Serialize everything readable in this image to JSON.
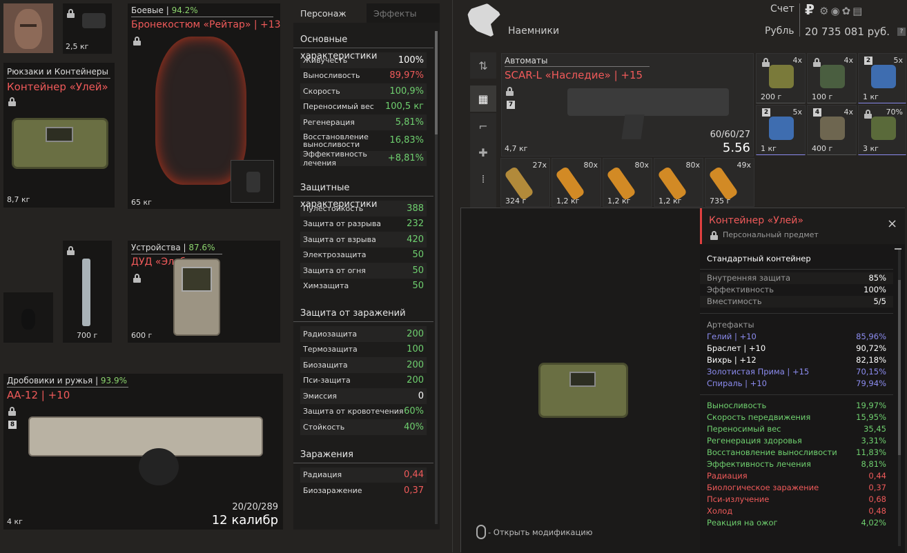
{
  "equipment": {
    "head_weight": "2,5 кг",
    "backpack": {
      "category": "Рюкзаки и Контейнеры",
      "name": "Контейнер «Улей»",
      "weight": "8,7 кг"
    },
    "armor": {
      "category": "Боевые",
      "durability": "94.2%",
      "name": "Бронекостюм «Рейтар» | +13",
      "weight": "65 кг"
    },
    "knife_weight": "700 г",
    "device": {
      "category": "Устройства",
      "durability": "87.6%",
      "name": "ДУД «Эльбрус»",
      "weight": "600 г"
    },
    "weapon": {
      "category": "Дробовики и ружья",
      "durability": "93.9%",
      "name": "АА-12 | +10",
      "weight": "4 кг",
      "ammo": "20/20/289",
      "caliber": "12 калибр",
      "badge": "8"
    }
  },
  "stats": {
    "tabs": [
      "Персонаж",
      "Эффекты"
    ],
    "main_title": "Основные характеристики",
    "main": [
      {
        "label": "Живучесть",
        "value": "100%",
        "color": "#ffffff"
      },
      {
        "label": "Выносливость",
        "value": "89,97%",
        "color": "#f05a5a"
      },
      {
        "label": "Скорость",
        "value": "100,9%",
        "color": "#6fd06f"
      },
      {
        "label": "Переносимый вес",
        "value": "100,5 кг",
        "color": "#6fd06f"
      },
      {
        "label": "Регенерация",
        "value": "5,81%",
        "color": "#6fd06f"
      },
      {
        "label": "Восстановление выносливости",
        "value": "16,83%",
        "color": "#6fd06f"
      },
      {
        "label": "Эффективность лечения",
        "value": "+8,81%",
        "color": "#6fd06f"
      }
    ],
    "prot_title": "Защитные характеристики",
    "prot": [
      {
        "label": "Пулестойкость",
        "value": "388"
      },
      {
        "label": "Защита от разрыва",
        "value": "232"
      },
      {
        "label": "Защита от взрыва",
        "value": "420"
      },
      {
        "label": "Электрозащита",
        "value": "50"
      },
      {
        "label": "Защита от огня",
        "value": "50"
      },
      {
        "label": "Химзащита",
        "value": "50"
      }
    ],
    "cont_title": "Защита от заражений",
    "cont": [
      {
        "label": "Радиозащита",
        "value": "200",
        "color": "#6fd06f"
      },
      {
        "label": "Термозащита",
        "value": "100",
        "color": "#6fd06f"
      },
      {
        "label": "Биозащита",
        "value": "200",
        "color": "#6fd06f"
      },
      {
        "label": "Пси-защита",
        "value": "200",
        "color": "#6fd06f"
      },
      {
        "label": "Эмиссия",
        "value": "0",
        "color": "#ffffff"
      },
      {
        "label": "Защита от кровотечения",
        "value": "60%",
        "color": "#6fd06f"
      },
      {
        "label": "Стойкость",
        "value": "40%",
        "color": "#6fd06f"
      }
    ],
    "inf_title": "Заражения",
    "inf": [
      {
        "label": "Радиация",
        "value": "0,44"
      },
      {
        "label": "Биозаражение",
        "value": "0,37"
      }
    ]
  },
  "header": {
    "faction": "Наемники",
    "account_label": "Счет",
    "currency": "Рубль",
    "money": "20 735 081 руб."
  },
  "rifle": {
    "category": "Автоматы",
    "name": "SCAR-L «Наследие» | +15",
    "weight": "4,7 кг",
    "ammo": "60/60/27",
    "caliber": "5.56",
    "badge": "7"
  },
  "top_items": [
    {
      "count": "4x",
      "weight": "200 г"
    },
    {
      "count": "4x",
      "weight": "100 г"
    },
    {
      "count": "5x",
      "weight": "1 кг",
      "badge": "2"
    },
    {
      "count": "5x",
      "weight": "1 кг",
      "badge": "2"
    },
    {
      "count": "4x",
      "weight": "400 г",
      "badge": "4"
    },
    {
      "count": "70%",
      "weight": "3 кг"
    }
  ],
  "ammo_items": [
    {
      "count": "27x",
      "weight": "324 г"
    },
    {
      "count": "80x",
      "weight": "1,2 кг"
    },
    {
      "count": "80x",
      "weight": "1,2 кг"
    },
    {
      "count": "80x",
      "weight": "1,2 кг"
    },
    {
      "count": "49x",
      "weight": "735 г"
    }
  ],
  "popup": {
    "title": "Контейнер «Улей»",
    "subtitle": "Персональный предмет",
    "type": "Стандартный контейнер",
    "props": [
      {
        "label": "Внутренняя защита",
        "value": "85%"
      },
      {
        "label": "Эффективность",
        "value": "100%"
      },
      {
        "label": "Вместимость",
        "value": "5/5"
      }
    ],
    "art_title": "Артефакты",
    "artifacts": [
      {
        "label": "Гелий | +10",
        "value": "85,96%",
        "color": "#8c8cf0"
      },
      {
        "label": "Браслет | +10",
        "value": "90,72%",
        "color": "#ffffff"
      },
      {
        "label": "Вихрь | +12",
        "value": "82,18%",
        "color": "#ffffff"
      },
      {
        "label": "Золотистая Прима | +15",
        "value": "70,15%",
        "color": "#8c8cf0"
      },
      {
        "label": "Спираль | +10",
        "value": "79,94%",
        "color": "#8c8cf0"
      }
    ],
    "effects": [
      {
        "label": "Выносливость",
        "value": "19,97%",
        "color": "#6fd06f"
      },
      {
        "label": "Скорость передвижения",
        "value": "15,95%",
        "color": "#6fd06f"
      },
      {
        "label": "Переносимый вес",
        "value": "35,45",
        "color": "#6fd06f"
      },
      {
        "label": "Регенерация здоровья",
        "value": "3,31%",
        "color": "#6fd06f"
      },
      {
        "label": "Восстановление выносливости",
        "value": "11,83%",
        "color": "#6fd06f"
      },
      {
        "label": "Эффективность лечения",
        "value": "8,81%",
        "color": "#6fd06f"
      },
      {
        "label": "Радиация",
        "value": "0,44",
        "color": "#f05a5a"
      },
      {
        "label": "Биологическое заражение",
        "value": "0,37",
        "color": "#f05a5a"
      },
      {
        "label": "Пси-излучение",
        "value": "0,68",
        "color": "#f05a5a"
      },
      {
        "label": "Холод",
        "value": "0,48",
        "color": "#f05a5a"
      },
      {
        "label": "Реакция на ожог",
        "value": "4,02%",
        "color": "#6fd06f"
      }
    ],
    "hint": "- Открыть модификацию"
  }
}
